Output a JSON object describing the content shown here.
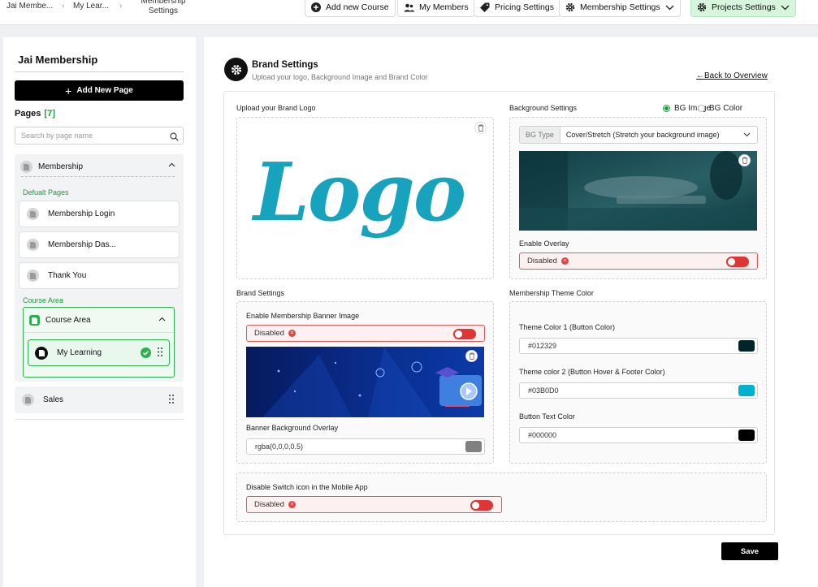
{
  "breadcrumb": {
    "item1": "Jai Membe...",
    "item2": "My Lear...",
    "item3": "Membership Settings"
  },
  "topnav": {
    "add_course": "Add new Course",
    "my_members": "My Members",
    "pricing_settings": "Pricing Settings",
    "membership_settings": "Membership Settings",
    "projects_settings": "Projects Settings"
  },
  "sidebar": {
    "title": "Jai Membership",
    "add_page": "Add New Page",
    "pages_label": "Pages",
    "pages_count": "[7]",
    "search_placeholder": "Search by page name",
    "group_name": "Membership",
    "default_pages_label": "Defualt Pages",
    "default_pages": [
      "Membership Login",
      "Membership Das...",
      "Thank You"
    ],
    "course_area_label": "Course Area",
    "course_area_name": "Course Area",
    "course_item": "My Learning",
    "sales": "Sales"
  },
  "header": {
    "title": "Brand Settings",
    "subtitle": "Upload your logo, Background Image and Brand Color",
    "back": "Back to Overview"
  },
  "logo_section": {
    "label": "Upload your Brand Logo",
    "logo_text": "Logo"
  },
  "background": {
    "label": "Background Settings",
    "option_image": "BG Image",
    "option_color": "BG Color",
    "selected": "BG Image",
    "bg_type_label": "BG Type",
    "bg_type_value": "Cover/Stretch (Stretch your background image)",
    "overlay_label": "Enable Overlay",
    "overlay_status": "Disabled"
  },
  "brand": {
    "label": "Brand Settings",
    "banner_label": "Enable Membership Banner Image",
    "banner_status": "Disabled",
    "overlay_label": "Banner Background Overlay",
    "overlay_value": "rgba(0,0,0,0.5)"
  },
  "theme": {
    "label": "Membership Theme Color",
    "color1_label": "Theme Color 1 (Button Color)",
    "color1_value": "#012329",
    "color2_label": "Theme color 2 (Button Hover & Footer Color)",
    "color2_value": "#03B0D0",
    "text_label": "Button Text Color",
    "text_value": "#000000"
  },
  "mobile": {
    "label": "Disable Switch icon in the Mobile App",
    "status": "Disabled"
  },
  "save": "Save",
  "colors": {
    "accent_green": "#1a9c3a",
    "danger_red": "#e03535",
    "logo_teal": "#17a2be",
    "overlay_swatch": "#808080"
  }
}
